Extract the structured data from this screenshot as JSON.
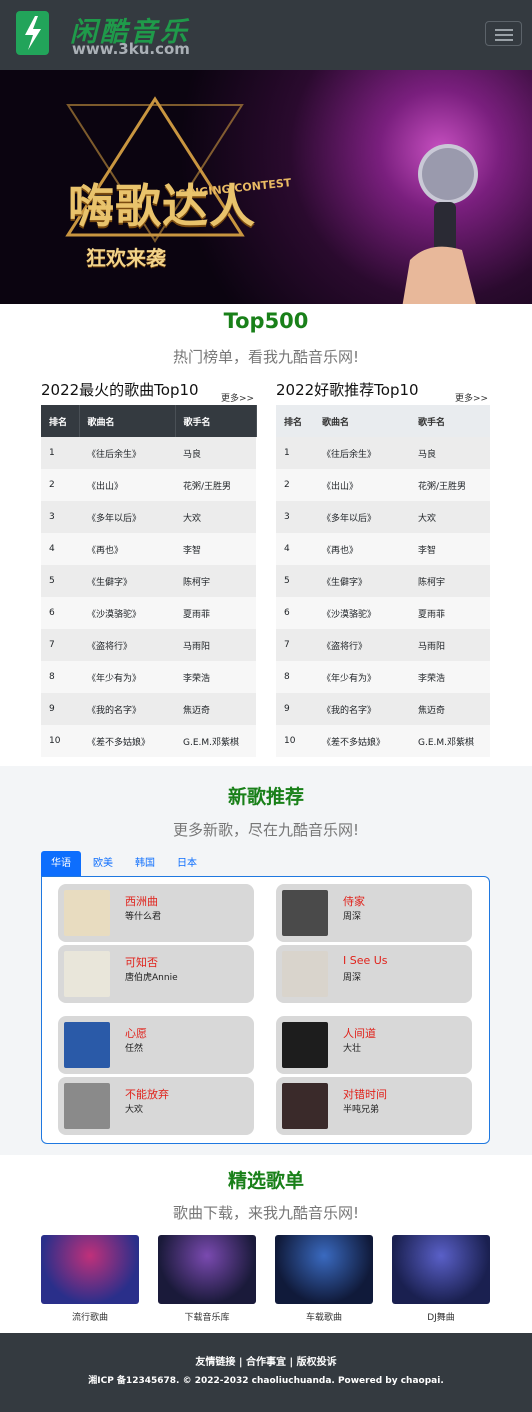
{
  "nav": {
    "logo_cn": "闲酷音乐",
    "logo_en": "www.3ku.com"
  },
  "banner": {
    "word1": "嗨歌达人",
    "word2": "狂欢来袭",
    "badge": "SINGING CONTEST"
  },
  "top500": {
    "title": "Top500",
    "subtitle": "热门榜单，看我九酷音乐网!"
  },
  "charts": {
    "more_label": "更多>>",
    "left": {
      "title": "2022最火的歌曲Top10",
      "headers": [
        "排名",
        "歌曲名",
        "歌手名"
      ],
      "rows": [
        {
          "rank": "1",
          "song": "《往后余生》",
          "artist": "马良"
        },
        {
          "rank": "2",
          "song": "《出山》",
          "artist": "花粥/王胜男"
        },
        {
          "rank": "3",
          "song": "《多年以后》",
          "artist": "大欢"
        },
        {
          "rank": "4",
          "song": "《再也》",
          "artist": "李智"
        },
        {
          "rank": "5",
          "song": "《生僻字》",
          "artist": "陈柯宇"
        },
        {
          "rank": "6",
          "song": "《沙漠骆驼》",
          "artist": "夏雨菲"
        },
        {
          "rank": "7",
          "song": "《盗将行》",
          "artist": "马雨阳"
        },
        {
          "rank": "8",
          "song": "《年少有为》",
          "artist": "李荣浩"
        },
        {
          "rank": "9",
          "song": "《我的名字》",
          "artist": "焦迈奇"
        },
        {
          "rank": "10",
          "song": "《差不多姑娘》",
          "artist": "G.E.M.邓紫棋"
        }
      ]
    },
    "right": {
      "title": "2022好歌推荐Top10",
      "headers": [
        "排名",
        "歌曲名",
        "歌手名"
      ],
      "rows": [
        {
          "rank": "1",
          "song": "《往后余生》",
          "artist": "马良"
        },
        {
          "rank": "2",
          "song": "《出山》",
          "artist": "花粥/王胜男"
        },
        {
          "rank": "3",
          "song": "《多年以后》",
          "artist": "大欢"
        },
        {
          "rank": "4",
          "song": "《再也》",
          "artist": "李智"
        },
        {
          "rank": "5",
          "song": "《生僻字》",
          "artist": "陈柯宇"
        },
        {
          "rank": "6",
          "song": "《沙漠骆驼》",
          "artist": "夏雨菲"
        },
        {
          "rank": "7",
          "song": "《盗将行》",
          "artist": "马雨阳"
        },
        {
          "rank": "8",
          "song": "《年少有为》",
          "artist": "李荣浩"
        },
        {
          "rank": "9",
          "song": "《我的名字》",
          "artist": "焦迈奇"
        },
        {
          "rank": "10",
          "song": "《差不多姑娘》",
          "artist": "G.E.M.邓紫棋"
        }
      ]
    }
  },
  "new_songs": {
    "title": "新歌推荐",
    "subtitle": "更多新歌，尽在九酷音乐网!",
    "tabs": [
      "华语",
      "欧美",
      "韩国",
      "日本"
    ],
    "active_tab": "华语",
    "cards": [
      {
        "name": "西洲曲",
        "artist": "等什么君",
        "thumb_color": "#e8dcc0"
      },
      {
        "name": "侍家",
        "artist": "周深",
        "thumb_color": "#4a4a4a"
      },
      {
        "name": "可知否",
        "artist": "唐伯虎Annie",
        "thumb_color": "#e9e6da"
      },
      {
        "name": "I See Us",
        "artist": "周深",
        "thumb_color": "#d9d4cc"
      },
      {
        "name": "心愿",
        "artist": "任然",
        "thumb_color": "#2a5aa8"
      },
      {
        "name": "人间道",
        "artist": "大壮",
        "thumb_color": "#1d1d1d"
      },
      {
        "name": "不能放弃",
        "artist": "大欢",
        "thumb_color": "#8a8a8a"
      },
      {
        "name": "对错时间",
        "artist": "半吨兄弟",
        "thumb_color": "#3a2a2a"
      }
    ]
  },
  "playlists": {
    "title": "精选歌单",
    "subtitle": "歌曲下载，来我九酷音乐网!",
    "items": [
      {
        "label": "流行歌曲",
        "color1": "#2a2f8a",
        "color2": "#c0307a"
      },
      {
        "label": "下载音乐库",
        "color1": "#1a1a3a",
        "color2": "#7a4ab0"
      },
      {
        "label": "车载歌曲",
        "color1": "#101a3a",
        "color2": "#3a6ac0"
      },
      {
        "label": "DJ舞曲",
        "color1": "#1a2050",
        "color2": "#5a60c8"
      }
    ]
  },
  "footer": {
    "links": "友情链接 | 合作事宜 | 版权投诉",
    "copyright": "湘ICP 备12345678. © 2022-2032 chaoliuchuanda. Powered by chaopai."
  }
}
